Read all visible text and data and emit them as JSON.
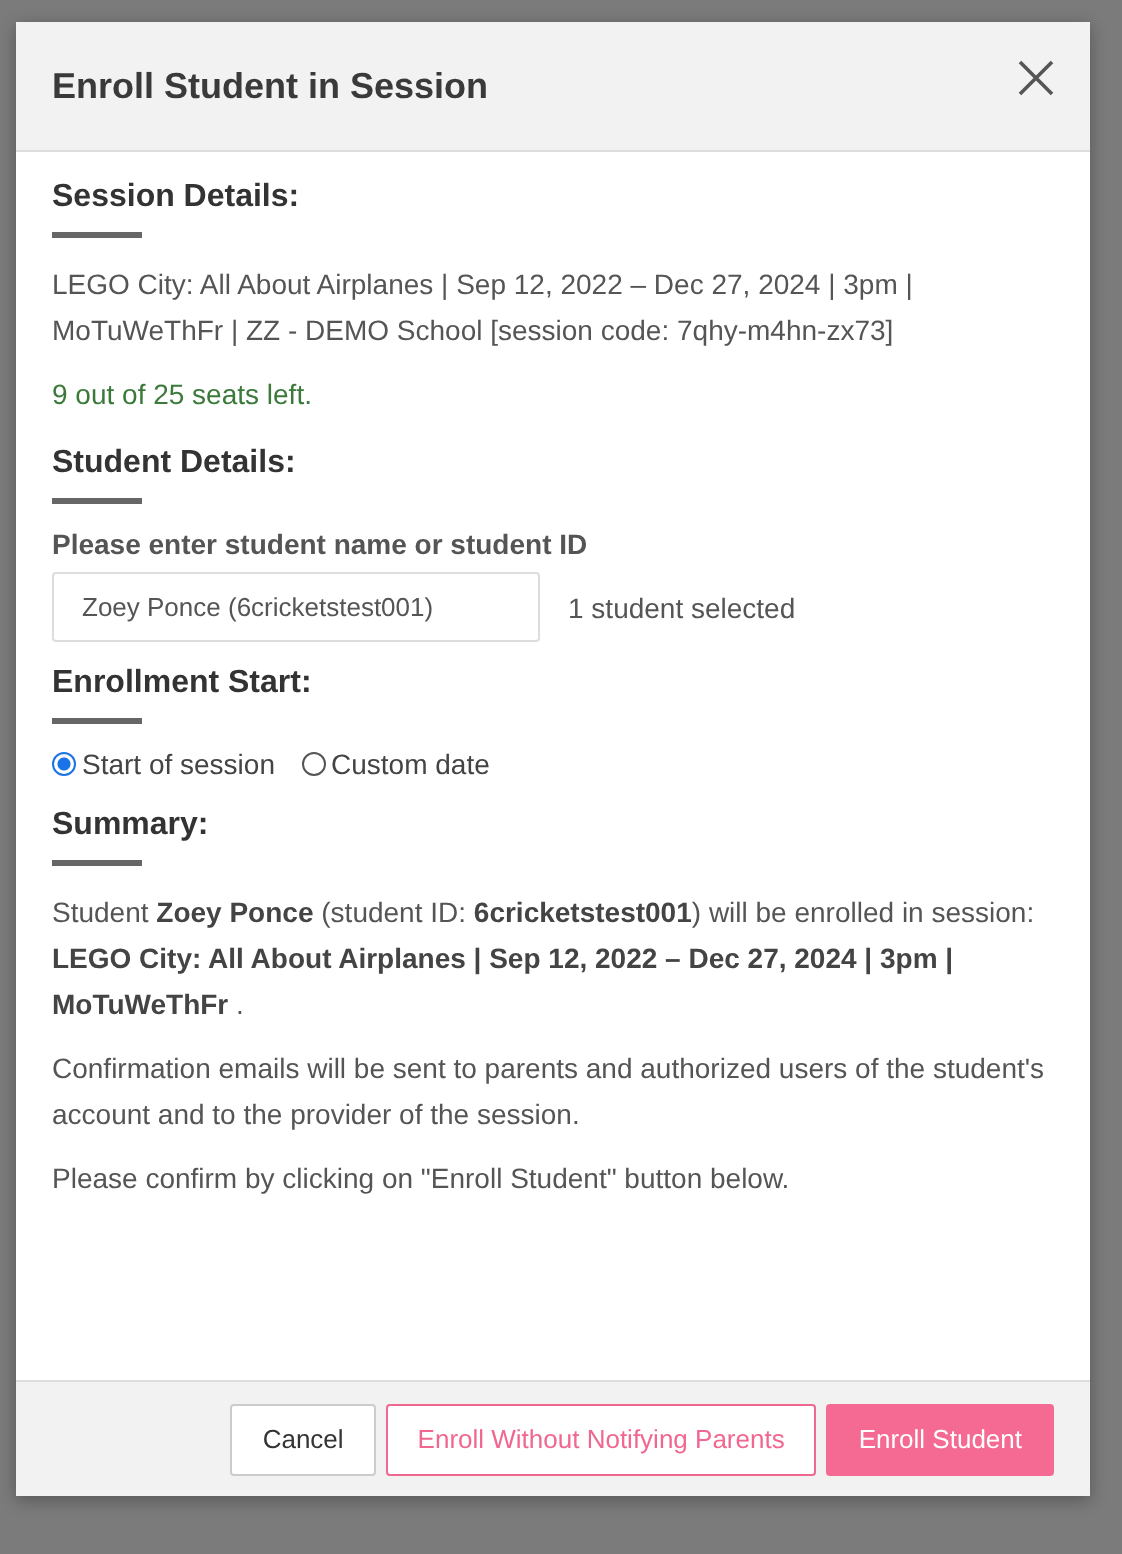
{
  "dialog": {
    "title": "Enroll Student in Session",
    "session_details": {
      "heading": "Session Details:",
      "description": "LEGO City: All About Airplanes | Sep 12, 2022 – Dec 27, 2024 | 3pm | MoTuWeThFr | ZZ - DEMO School [session code: 7qhy-m4hn-zx73]",
      "seats": "9 out of 25 seats left."
    },
    "student_details": {
      "heading": "Student Details:",
      "field_label": "Please enter student name or student ID",
      "field_value": "Zoey Ponce (6cricketstest001)",
      "selection_count": "1 student selected"
    },
    "enrollment_start": {
      "heading": "Enrollment Start:",
      "options": [
        {
          "label": "Start of session",
          "selected": true
        },
        {
          "label": "Custom date",
          "selected": false
        }
      ]
    },
    "summary": {
      "heading": "Summary:",
      "paragraphs": [
        "Student **Zoey Ponce** (student ID: **6cricketstest001**) will be enrolled in session: **LEGO City: All About Airplanes | Sep 12, 2022 – Dec 27, 2024 | 3pm | MoTuWeThFr** .",
        "Confirmation emails will be sent to parents and authorized users of the student's account and to the provider of the session.",
        "Please confirm by clicking on \"Enroll Student\" button below."
      ]
    },
    "buttons": [
      {
        "label": "Cancel",
        "kind": "plain"
      },
      {
        "label": "Enroll Without Notifying Parents",
        "kind": "outline"
      },
      {
        "label": "Enroll Student",
        "kind": "primary"
      }
    ]
  }
}
